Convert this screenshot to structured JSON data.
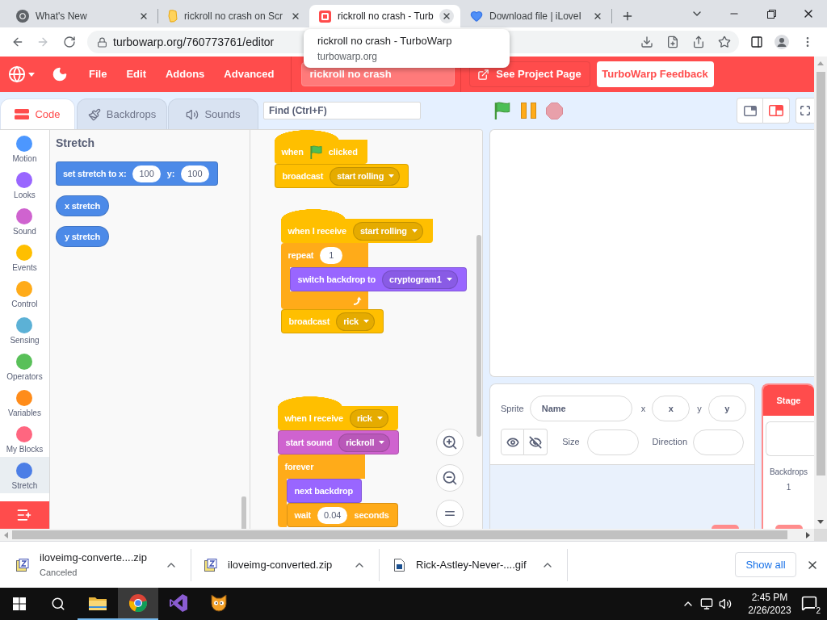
{
  "browser": {
    "tabs": [
      {
        "title": "What's New",
        "selected": false
      },
      {
        "title": "rickroll no crash on Scr",
        "selected": false
      },
      {
        "title": "rickroll no crash - Turb",
        "selected": true
      },
      {
        "title": "Download file | iLoveI",
        "selected": false
      }
    ],
    "url": "turbowarp.org/760773761/editor",
    "hover_card": {
      "title": "rickroll no crash - TurboWarp",
      "host": "turbowarp.org"
    }
  },
  "menu_bar": {
    "items": [
      "File",
      "Edit",
      "Addons",
      "Advanced"
    ],
    "project_title": "rickroll no crash",
    "buttons": [
      {
        "label": "See Project Page",
        "kind": "outline"
      },
      {
        "label": "TurboWarp Feedback",
        "kind": "filled"
      }
    ]
  },
  "editor_tabs": [
    {
      "label": "Code",
      "selected": true
    },
    {
      "label": "Backdrops",
      "selected": false
    },
    {
      "label": "Sounds",
      "selected": false
    }
  ],
  "find_field": {
    "placeholder": "Find (Ctrl+F)"
  },
  "stage_size_buttons": [
    {
      "selected": false
    },
    {
      "selected": true
    }
  ],
  "categories": [
    {
      "label": "Motion",
      "color": "#4c97ff",
      "selected": false
    },
    {
      "label": "Looks",
      "color": "#9966ff",
      "selected": false
    },
    {
      "label": "Sound",
      "color": "#cf63cf",
      "selected": false
    },
    {
      "label": "Events",
      "color": "#ffbf00",
      "selected": false
    },
    {
      "label": "Control",
      "color": "#ffab19",
      "selected": false
    },
    {
      "label": "Sensing",
      "color": "#5cb1d6",
      "selected": false
    },
    {
      "label": "Operators",
      "color": "#59c059",
      "selected": false
    },
    {
      "label": "Variables",
      "color": "#ff8c1a",
      "selected": false
    },
    {
      "label": "My Blocks",
      "color": "#ff6680",
      "selected": false
    },
    {
      "label": "Stretch",
      "color": "#4c7ee6",
      "selected": true
    }
  ],
  "palette": {
    "heading": "Stretch",
    "blocks": [
      {
        "kind": "stack",
        "color": "#4c8ae8",
        "parts": [
          {
            "kind": "text",
            "text": "set stretch to x:"
          },
          {
            "kind": "number",
            "text": "100"
          },
          {
            "kind": "text",
            "text": "y:"
          },
          {
            "kind": "number",
            "text": "100"
          }
        ]
      },
      {
        "kind": "reporter",
        "color": "#4c8ae8",
        "parts": [
          {
            "kind": "text",
            "text": "x stretch"
          }
        ]
      },
      {
        "kind": "reporter",
        "color": "#4c8ae8",
        "parts": [
          {
            "kind": "text",
            "text": "y stretch"
          }
        ]
      }
    ]
  },
  "scripts": [
    {
      "blocks": [
        {
          "kind": "hat",
          "color": "#ffbf00",
          "parts": [
            {
              "kind": "text",
              "text": "when"
            },
            {
              "kind": "icon"
            },
            {
              "kind": "text",
              "text": "clicked"
            }
          ]
        },
        {
          "kind": "stack",
          "color": "#ffbf00",
          "parts": [
            {
              "kind": "text",
              "text": "broadcast"
            },
            {
              "kind": "dropdown",
              "text": "start rolling"
            }
          ]
        }
      ]
    },
    {
      "blocks": [
        {
          "kind": "hat",
          "color": "#ffbf00",
          "parts": [
            {
              "kind": "text",
              "text": "when I receive"
            },
            {
              "kind": "dropdown",
              "text": "start rolling"
            }
          ]
        },
        {
          "kind": "c",
          "color": "#ffab19",
          "bottom_visible": true,
          "parts": [
            {
              "kind": "text",
              "text": "repeat"
            },
            {
              "kind": "number",
              "text": "1"
            }
          ],
          "children": [
            {
              "kind": "stack",
              "color": "#9966ff",
              "parts": [
                {
                  "kind": "text",
                  "text": "switch backdrop to"
                },
                {
                  "kind": "dropdown",
                  "text": "cryptogram1"
                }
              ]
            }
          ]
        },
        {
          "kind": "stack",
          "color": "#ffbf00",
          "parts": [
            {
              "kind": "text",
              "text": "broadcast"
            },
            {
              "kind": "dropdown",
              "text": "rick"
            }
          ]
        }
      ]
    },
    {
      "blocks": [
        {
          "kind": "hat",
          "color": "#ffbf00",
          "parts": [
            {
              "kind": "text",
              "text": "when I receive"
            },
            {
              "kind": "dropdown",
              "text": "rick"
            }
          ]
        },
        {
          "kind": "stack",
          "color": "#cf63cf",
          "parts": [
            {
              "kind": "text",
              "text": "start sound"
            },
            {
              "kind": "dropdown",
              "text": "rickroll"
            }
          ]
        },
        {
          "kind": "c",
          "color": "#ffab19",
          "bottom_visible": false,
          "parts": [
            {
              "kind": "text",
              "text": "forever"
            }
          ],
          "children": [
            {
              "kind": "stack",
              "color": "#9966ff",
              "parts": [
                {
                  "kind": "text",
                  "text": "next backdrop"
                }
              ]
            },
            {
              "kind": "stack",
              "color": "#ffab19",
              "parts": [
                {
                  "kind": "text",
                  "text": "wait"
                },
                {
                  "kind": "number",
                  "text": "0.04"
                },
                {
                  "kind": "text",
                  "text": "seconds"
                }
              ]
            }
          ]
        }
      ]
    }
  ],
  "sprite_info": {
    "label": "Sprite",
    "name_field": {
      "placeholder": "Name"
    },
    "x_label": "x",
    "x_field": {
      "placeholder": "x"
    },
    "y_label": "y",
    "y_field": {
      "placeholder": "y"
    },
    "size_label": "Size",
    "direction_label": "Direction"
  },
  "stage_panel": {
    "title": "Stage",
    "backdrops_label": "Backdrops",
    "backdrop_count": "1"
  },
  "downloads": {
    "items": [
      {
        "name": "iloveimg-converte....zip",
        "status": "Canceled"
      },
      {
        "name": "iloveimg-converted.zip"
      },
      {
        "name": "Rick-Astley-Never-....gif"
      }
    ],
    "show_all": "Show all"
  },
  "taskbar": {
    "apps": [
      {
        "selected": false,
        "running": true
      },
      {
        "selected": true,
        "running": true
      },
      {
        "selected": false,
        "running": false
      },
      {
        "selected": false,
        "running": false
      }
    ],
    "time": "2:45 PM",
    "date": "2/26/2023",
    "notification_count": "2"
  }
}
